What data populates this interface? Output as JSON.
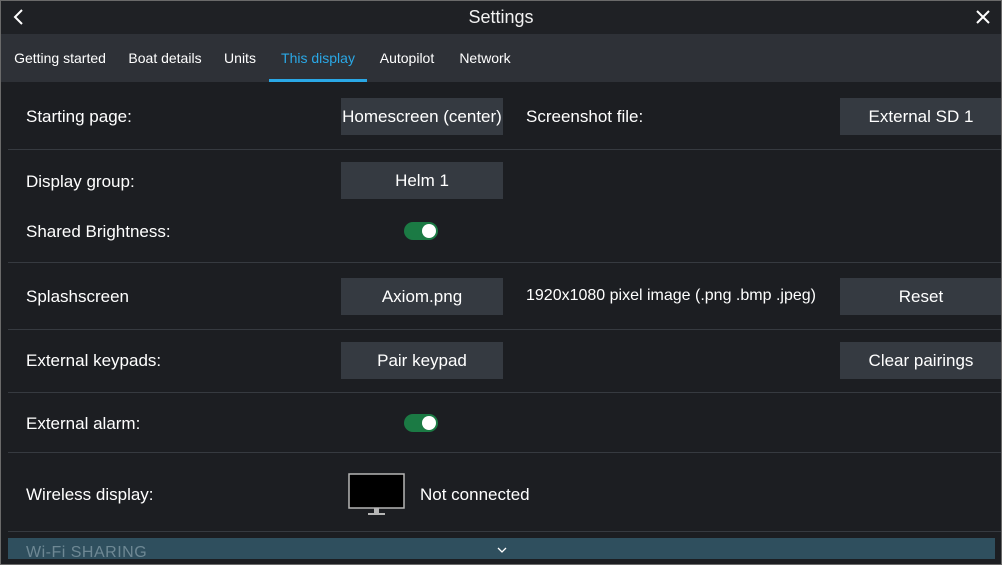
{
  "window": {
    "title": "Settings"
  },
  "tabs": [
    {
      "label": "Getting started"
    },
    {
      "label": "Boat details"
    },
    {
      "label": "Units"
    },
    {
      "label": "This display",
      "active": true
    },
    {
      "label": "Autopilot"
    },
    {
      "label": "Network"
    }
  ],
  "starting_page": {
    "label": "Starting page:",
    "value": "Homescreen (center)"
  },
  "screenshot_file": {
    "label": "Screenshot file:",
    "value": "External SD 1"
  },
  "display_group": {
    "label": "Display group:",
    "value": "Helm 1"
  },
  "shared_brightness": {
    "label": "Shared Brightness:",
    "on": true
  },
  "splashscreen": {
    "label": "Splashscreen",
    "value": "Axiom.png",
    "note": "1920x1080 pixel image (.png .bmp .jpeg)",
    "reset_label": "Reset"
  },
  "external_keypads": {
    "label": "External keypads:",
    "pair_label": "Pair keypad",
    "clear_label": "Clear pairings"
  },
  "external_alarm": {
    "label": "External alarm:",
    "on": true
  },
  "wireless_display": {
    "label": "Wireless display:",
    "status": "Not connected"
  },
  "wifi_sharing": {
    "label": "Wi-Fi SHARING"
  },
  "colors": {
    "accent": "#2aa8e6",
    "toggle_on": "#1b7a44",
    "button_bg": "#353a41",
    "panel_bg": "#1c1e22",
    "tabbar_bg": "#2e3137"
  }
}
